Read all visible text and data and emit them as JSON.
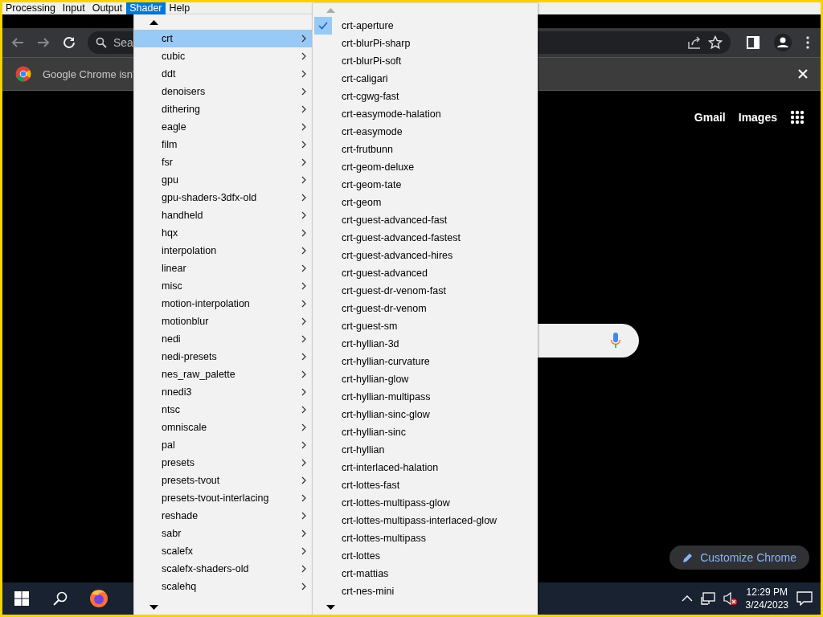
{
  "menu_bar": {
    "items": [
      {
        "label": "Processing",
        "selected": false
      },
      {
        "label": "Input",
        "selected": false
      },
      {
        "label": "Output",
        "selected": false
      },
      {
        "label": "Shader",
        "selected": true
      },
      {
        "label": "Help",
        "selected": false
      }
    ]
  },
  "browser": {
    "address_bar": {
      "placeholder": "Sea"
    },
    "infobar": {
      "text": "Google Chrome isn'"
    },
    "header_links": [
      "Gmail",
      "Images"
    ],
    "customize_button": "Customize Chrome"
  },
  "shader_menu": {
    "items": [
      {
        "label": "crt",
        "selected": true
      },
      {
        "label": "cubic",
        "selected": false
      },
      {
        "label": "ddt",
        "selected": false
      },
      {
        "label": "denoisers",
        "selected": false
      },
      {
        "label": "dithering",
        "selected": false
      },
      {
        "label": "eagle",
        "selected": false
      },
      {
        "label": "film",
        "selected": false
      },
      {
        "label": "fsr",
        "selected": false
      },
      {
        "label": "gpu",
        "selected": false
      },
      {
        "label": "gpu-shaders-3dfx-old",
        "selected": false
      },
      {
        "label": "handheld",
        "selected": false
      },
      {
        "label": "hqx",
        "selected": false
      },
      {
        "label": "interpolation",
        "selected": false
      },
      {
        "label": "linear",
        "selected": false
      },
      {
        "label": "misc",
        "selected": false
      },
      {
        "label": "motion-interpolation",
        "selected": false
      },
      {
        "label": "motionblur",
        "selected": false
      },
      {
        "label": "nedi",
        "selected": false
      },
      {
        "label": "nedi-presets",
        "selected": false
      },
      {
        "label": "nes_raw_palette",
        "selected": false
      },
      {
        "label": "nnedi3",
        "selected": false
      },
      {
        "label": "ntsc",
        "selected": false
      },
      {
        "label": "omniscale",
        "selected": false
      },
      {
        "label": "pal",
        "selected": false
      },
      {
        "label": "presets",
        "selected": false
      },
      {
        "label": "presets-tvout",
        "selected": false
      },
      {
        "label": "presets-tvout-interlacing",
        "selected": false
      },
      {
        "label": "reshade",
        "selected": false
      },
      {
        "label": "sabr",
        "selected": false
      },
      {
        "label": "scalefx",
        "selected": false
      },
      {
        "label": "scalefx-shaders-old",
        "selected": false
      },
      {
        "label": "scalehq",
        "selected": false
      }
    ]
  },
  "crt_submenu": {
    "items": [
      {
        "label": "crt-aperture",
        "checked": true
      },
      {
        "label": "crt-blurPi-sharp",
        "checked": false
      },
      {
        "label": "crt-blurPi-soft",
        "checked": false
      },
      {
        "label": "crt-caligari",
        "checked": false
      },
      {
        "label": "crt-cgwg-fast",
        "checked": false
      },
      {
        "label": "crt-easymode-halation",
        "checked": false
      },
      {
        "label": "crt-easymode",
        "checked": false
      },
      {
        "label": "crt-frutbunn",
        "checked": false
      },
      {
        "label": "crt-geom-deluxe",
        "checked": false
      },
      {
        "label": "crt-geom-tate",
        "checked": false
      },
      {
        "label": "crt-geom",
        "checked": false
      },
      {
        "label": "crt-guest-advanced-fast",
        "checked": false
      },
      {
        "label": "crt-guest-advanced-fastest",
        "checked": false
      },
      {
        "label": "crt-guest-advanced-hires",
        "checked": false
      },
      {
        "label": "crt-guest-advanced",
        "checked": false
      },
      {
        "label": "crt-guest-dr-venom-fast",
        "checked": false
      },
      {
        "label": "crt-guest-dr-venom",
        "checked": false
      },
      {
        "label": "crt-guest-sm",
        "checked": false
      },
      {
        "label": "crt-hyllian-3d",
        "checked": false
      },
      {
        "label": "crt-hyllian-curvature",
        "checked": false
      },
      {
        "label": "crt-hyllian-glow",
        "checked": false
      },
      {
        "label": "crt-hyllian-multipass",
        "checked": false
      },
      {
        "label": "crt-hyllian-sinc-glow",
        "checked": false
      },
      {
        "label": "crt-hyllian-sinc",
        "checked": false
      },
      {
        "label": "crt-hyllian",
        "checked": false
      },
      {
        "label": "crt-interlaced-halation",
        "checked": false
      },
      {
        "label": "crt-lottes-fast",
        "checked": false
      },
      {
        "label": "crt-lottes-multipass-glow",
        "checked": false
      },
      {
        "label": "crt-lottes-multipass-interlaced-glow",
        "checked": false
      },
      {
        "label": "crt-lottes-multipass",
        "checked": false
      },
      {
        "label": "crt-lottes",
        "checked": false
      },
      {
        "label": "crt-mattias",
        "checked": false
      },
      {
        "label": "crt-nes-mini",
        "checked": false
      }
    ]
  },
  "taskbar": {
    "time": "12:29 PM",
    "date": "3/24/2023"
  }
}
